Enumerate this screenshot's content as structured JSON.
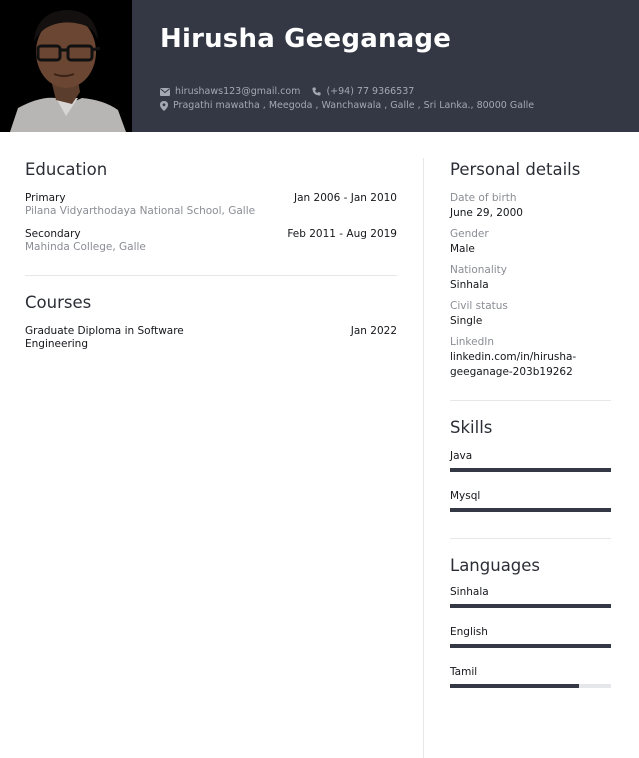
{
  "header": {
    "name": "Hirusha Geeganage",
    "email": "hirushaws123@gmail.com",
    "phone": "(+94) 77 9366537",
    "address": "Pragathi mawatha , Meegoda , Wanchawala , Galle , Sri Lanka., 80000 Galle",
    "icons": {
      "email": "envelope-icon",
      "phone": "phone-icon",
      "address": "map-pin-icon"
    }
  },
  "education": {
    "title": "Education",
    "entries": [
      {
        "title": "Primary",
        "subtitle": "Pilana Vidyarthodaya National School, Galle",
        "dates": "Jan 2006 - Jan 2010"
      },
      {
        "title": "Secondary",
        "subtitle": "Mahinda College, Galle",
        "dates": "Feb 2011 - Aug 2019"
      }
    ]
  },
  "courses": {
    "title": "Courses",
    "entries": [
      {
        "title_line1": "Graduate Diploma in Software",
        "title_line2": "Engineering",
        "dates": "Jan 2022"
      }
    ]
  },
  "personal": {
    "title": "Personal details",
    "items": [
      {
        "label": "Date of birth",
        "value": "June 29, 2000"
      },
      {
        "label": "Gender",
        "value": "Male"
      },
      {
        "label": "Nationality",
        "value": "Sinhala"
      },
      {
        "label": "Civil status",
        "value": "Single"
      },
      {
        "label": "LinkedIn",
        "value_line1": "linkedin.com/in/hirusha-",
        "value_line2": "geeganage-203b19262"
      }
    ]
  },
  "skills": {
    "title": "Skills",
    "items": [
      {
        "name": "Java",
        "level": 1.0
      },
      {
        "name": "Mysql",
        "level": 1.0
      }
    ]
  },
  "languages": {
    "title": "Languages",
    "items": [
      {
        "name": "Sinhala",
        "level": 1.0
      },
      {
        "name": "English",
        "level": 1.0
      },
      {
        "name": "Tamil",
        "level": 0.8
      }
    ]
  },
  "colors": {
    "header_bg": "#333844",
    "bar_fill": "#333844",
    "bar_track": "#e6e7ea"
  }
}
